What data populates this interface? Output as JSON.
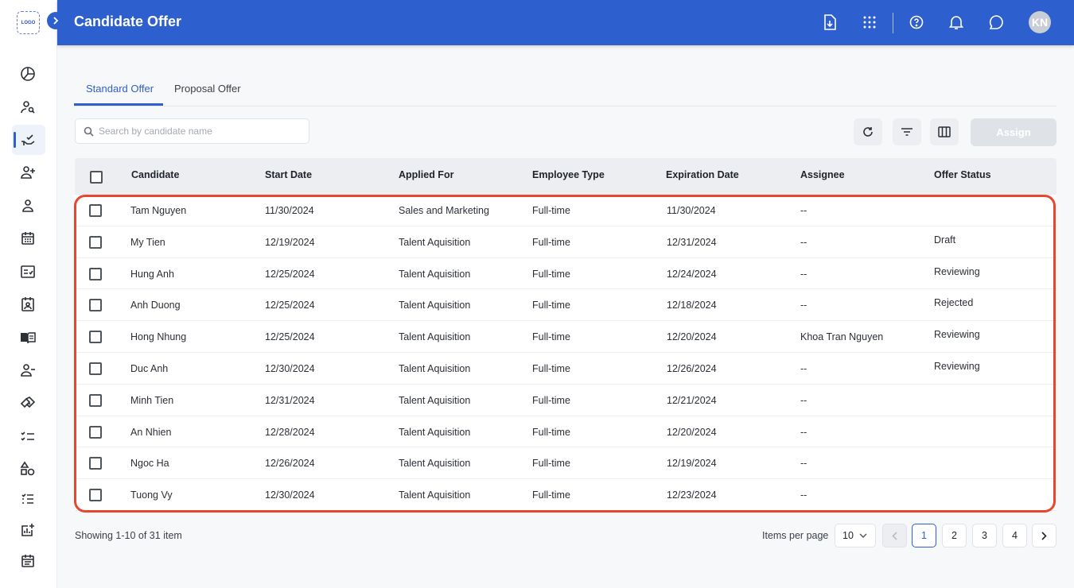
{
  "app": {
    "logo_text": "LOGO",
    "title": "Candidate Offer",
    "avatar_initials": "KN",
    "accent_color": "#2d5fcf",
    "highlight_color": "#e8472f"
  },
  "sidebar": {
    "items": [
      {
        "name": "dashboard-icon"
      },
      {
        "name": "candidate-search-icon"
      },
      {
        "name": "offer-hand-check-icon",
        "active": true
      },
      {
        "name": "add-user-icon"
      },
      {
        "name": "person-icon"
      },
      {
        "name": "calendar-icon"
      },
      {
        "name": "checklist-form-icon"
      },
      {
        "name": "id-card-icon"
      },
      {
        "name": "book-icon"
      },
      {
        "name": "remove-user-icon"
      },
      {
        "name": "handshake-icon"
      },
      {
        "name": "tasks-icon"
      },
      {
        "name": "shapes-icon"
      },
      {
        "name": "list-icon"
      },
      {
        "name": "report-chart-icon"
      },
      {
        "name": "schedule-icon"
      }
    ]
  },
  "tabs": [
    {
      "label": "Standard Offer",
      "active": true
    },
    {
      "label": "Proposal Offer",
      "active": false
    }
  ],
  "search": {
    "placeholder": "Search by candidate name",
    "value": ""
  },
  "toolbar": {
    "assign_label": "Assign"
  },
  "table": {
    "columns": [
      "Candidate",
      "Start Date",
      "Applied For",
      "Employee Type",
      "Expiration Date",
      "Assignee",
      "Offer Status"
    ],
    "rows": [
      {
        "candidate": "Tam Nguyen",
        "start": "11/30/2024",
        "applied": "Sales and Marketing",
        "type": "Full-time",
        "expiration": "11/30/2024",
        "assignee": "--",
        "status": ""
      },
      {
        "candidate": "My Tien",
        "start": "12/19/2024",
        "applied": "Talent Aquisition",
        "type": "Full-time",
        "expiration": "12/31/2024",
        "assignee": "--",
        "status": "Draft"
      },
      {
        "candidate": "Hung Anh",
        "start": "12/25/2024",
        "applied": "Talent Aquisition",
        "type": "Full-time",
        "expiration": "12/24/2024",
        "assignee": "--",
        "status": "Reviewing"
      },
      {
        "candidate": "Anh Duong",
        "start": "12/25/2024",
        "applied": "Talent Aquisition",
        "type": "Full-time",
        "expiration": "12/18/2024",
        "assignee": "--",
        "status": "Rejected"
      },
      {
        "candidate": "Hong Nhung",
        "start": "12/25/2024",
        "applied": "Talent Aquisition",
        "type": "Full-time",
        "expiration": "12/20/2024",
        "assignee": "Khoa Tran Nguyen",
        "status": "Reviewing"
      },
      {
        "candidate": "Duc Anh",
        "start": "12/30/2024",
        "applied": "Talent Aquisition",
        "type": "Full-time",
        "expiration": "12/26/2024",
        "assignee": "--",
        "status": "Reviewing"
      },
      {
        "candidate": "Minh Tien",
        "start": "12/31/2024",
        "applied": "Talent Aquisition",
        "type": "Full-time",
        "expiration": "12/21/2024",
        "assignee": "--",
        "status": ""
      },
      {
        "candidate": "An Nhien",
        "start": "12/28/2024",
        "applied": "Talent Aquisition",
        "type": "Full-time",
        "expiration": "12/20/2024",
        "assignee": "--",
        "status": ""
      },
      {
        "candidate": "Ngoc Ha",
        "start": "12/26/2024",
        "applied": "Talent Aquisition",
        "type": "Full-time",
        "expiration": "12/19/2024",
        "assignee": "--",
        "status": ""
      },
      {
        "candidate": "Tuong Vy",
        "start": "12/30/2024",
        "applied": "Talent Aquisition",
        "type": "Full-time",
        "expiration": "12/23/2024",
        "assignee": "--",
        "status": ""
      }
    ]
  },
  "footer": {
    "showing": "Showing 1-10 of 31 item",
    "items_per_page_label": "Items per page",
    "items_per_page_value": "10",
    "pages": [
      "1",
      "2",
      "3",
      "4"
    ],
    "current_page": "1"
  }
}
